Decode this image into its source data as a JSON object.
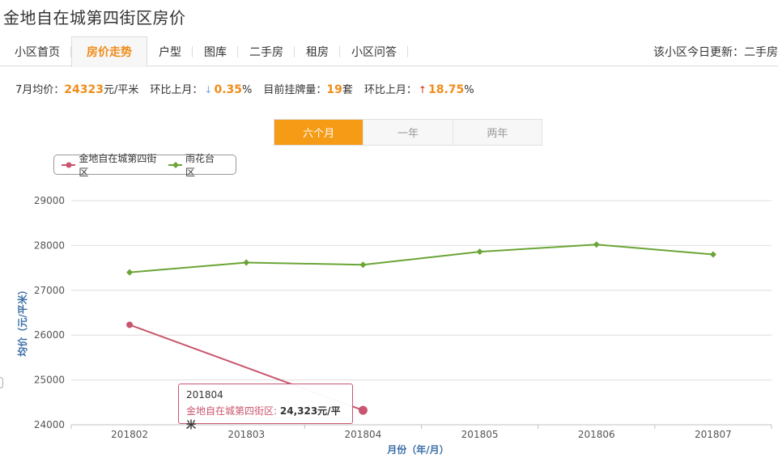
{
  "page": {
    "title": "金地自在城第四街区房价"
  },
  "tabs": [
    {
      "label": "小区首页"
    },
    {
      "label": "房价走势",
      "active": true
    },
    {
      "label": "户型"
    },
    {
      "label": "图库"
    },
    {
      "label": "二手房"
    },
    {
      "label": "租房"
    },
    {
      "label": "小区问答"
    }
  ],
  "update_notice": "该小区今日更新：二手房",
  "stats": {
    "avg_label": "7月均价：",
    "avg_value": "24323",
    "avg_unit": "元/平米",
    "mom_label_1": "环比上月：",
    "mom_value_1": "0.35",
    "mom_direction_1": "down",
    "listing_label": "目前挂牌量：",
    "listing_value": "19",
    "listing_unit": "套",
    "mom_label_2": "环比上月：",
    "mom_value_2": "18.75",
    "mom_direction_2": "up",
    "percent": "%"
  },
  "range_options": [
    {
      "label": "六个月",
      "active": true
    },
    {
      "label": "一年"
    },
    {
      "label": "两年"
    }
  ],
  "colors": {
    "accent": "#f59b16",
    "series_a": "#c9566e",
    "series_b": "#6aa536"
  },
  "chart_data": {
    "type": "line",
    "categories": [
      "201802",
      "201803",
      "201804",
      "201805",
      "201806",
      "201807"
    ],
    "series": [
      {
        "name": "金地自在城第四街区",
        "color": "#c9566e",
        "marker": "circle",
        "values": [
          26230,
          null,
          24323,
          null,
          null,
          null
        ]
      },
      {
        "name": "雨花台区",
        "color": "#6aa536",
        "marker": "diamond",
        "values": [
          27400,
          27620,
          27570,
          27860,
          28020,
          27800
        ]
      }
    ],
    "xlabel": "月份（年/月）",
    "ylabel": "均价（元/平米）",
    "ylim": [
      24000,
      29000
    ],
    "yticks": [
      24000,
      25000,
      26000,
      27000,
      28000,
      29000
    ],
    "grid": true,
    "legend_position": "top-left",
    "tooltip": {
      "x": "201804",
      "series": "金地自在城第四街区",
      "value": "24,323元/平米"
    }
  }
}
